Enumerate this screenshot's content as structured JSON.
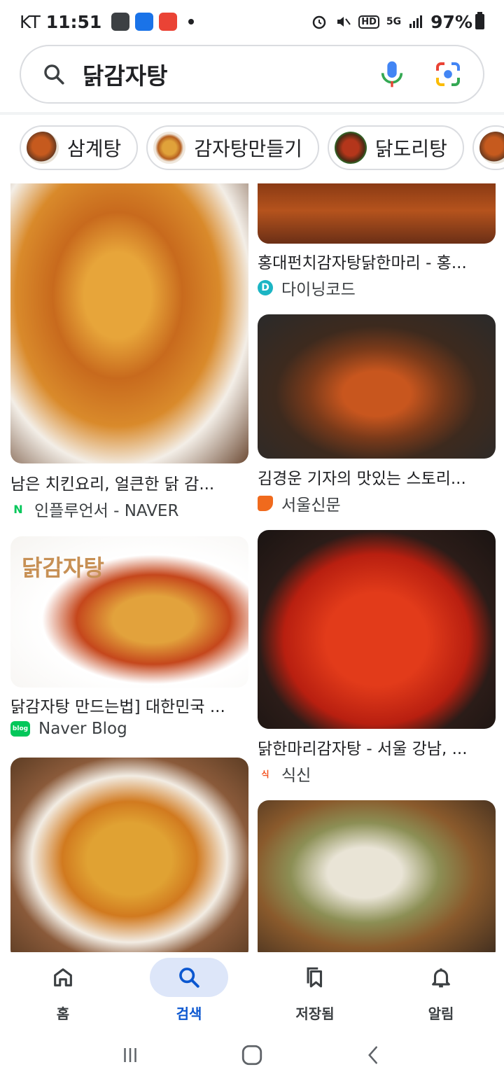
{
  "status_bar": {
    "carrier": "KT",
    "time": "11:51",
    "network": "5G",
    "hd": "HD",
    "battery": "97%"
  },
  "search": {
    "query": "닭감자탕"
  },
  "chips": [
    {
      "label": "삼계탕"
    },
    {
      "label": "감자탕만들기"
    },
    {
      "label": "닭도리탕"
    }
  ],
  "results": [
    {
      "title": "남은 치킨요리, 얼큰한 닭 감...",
      "source": "인플루언서 - NAVER",
      "favicon": "naver-n-icon"
    },
    {
      "title": "홍대펀치감자탕닭한마리 - 홍...",
      "source": "다이닝코드",
      "favicon": "diningcode-icon"
    },
    {
      "title": "김경운 기자의 맛있는 스토리...",
      "source": "서울신문",
      "favicon": "seoul-shinmun-icon"
    },
    {
      "title": "닭감자탕 만드는법] 대한민국 ...",
      "source": "Naver Blog",
      "favicon": "naver-blog-icon",
      "image_text": "닭감자탕"
    },
    {
      "title": "닭한마리감자탕 - 서울 강남, ...",
      "source": "식신",
      "favicon": "siksin-icon"
    },
    {
      "title": "",
      "source": "",
      "favicon": ""
    },
    {
      "title": "",
      "source": "",
      "favicon": ""
    }
  ],
  "bottom_nav": [
    {
      "label": "홈",
      "icon": "home-icon"
    },
    {
      "label": "검색",
      "icon": "search-icon",
      "active": true
    },
    {
      "label": "저장됨",
      "icon": "bookmarks-icon"
    },
    {
      "label": "알림",
      "icon": "bell-icon"
    }
  ],
  "colors": {
    "accent": "#0b57d0",
    "active_pill": "#dde6f9"
  }
}
